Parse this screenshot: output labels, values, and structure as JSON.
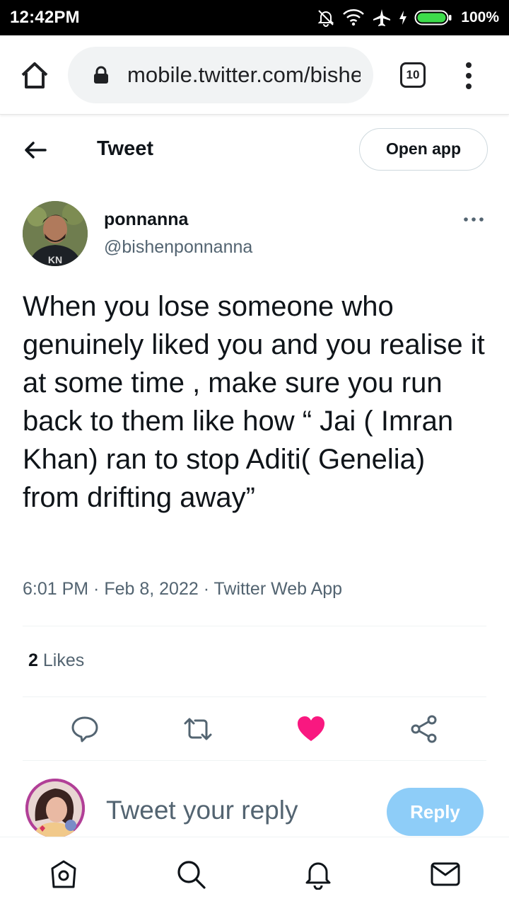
{
  "status_bar": {
    "time": "12:42PM",
    "battery_percent": "100%",
    "icons": [
      "bell-muted-icon",
      "wifi-icon",
      "airplane-icon",
      "charging-icon",
      "battery-icon"
    ]
  },
  "browser": {
    "url": "mobile.twitter.com/bishenponnanna/status",
    "tab_count": "10",
    "icons": [
      "home-icon",
      "lock-icon",
      "tabs-icon",
      "more-vert-icon"
    ]
  },
  "header": {
    "title": "Tweet",
    "open_app_label": "Open app"
  },
  "tweet": {
    "author_name": "ponnanna",
    "author_handle": "@bishenponnanna",
    "text": "When you lose someone who genuinely liked you and you realise it at some time , make sure you run back to them like how “ Jai ( Imran Khan) ran to stop Aditi( Genelia) from drifting away”",
    "meta": "6:01 PM · Feb 8, 2022 · Twitter Web App",
    "likes_count": "2",
    "likes_label": "Likes"
  },
  "actions": {
    "liked": true,
    "like_color": "#f91880",
    "icons": [
      "reply-icon",
      "retweet-icon",
      "heart-icon",
      "share-icon"
    ]
  },
  "composer": {
    "placeholder": "Tweet your reply",
    "reply_label": "Reply",
    "reply_color": "#8ecdf8"
  },
  "bottom_nav": {
    "icons": [
      "home-icon",
      "search-icon",
      "notifications-icon",
      "messages-icon"
    ]
  },
  "colors": {
    "text_primary": "#0f1419",
    "text_secondary": "#536471",
    "divider": "#eff3f4"
  }
}
